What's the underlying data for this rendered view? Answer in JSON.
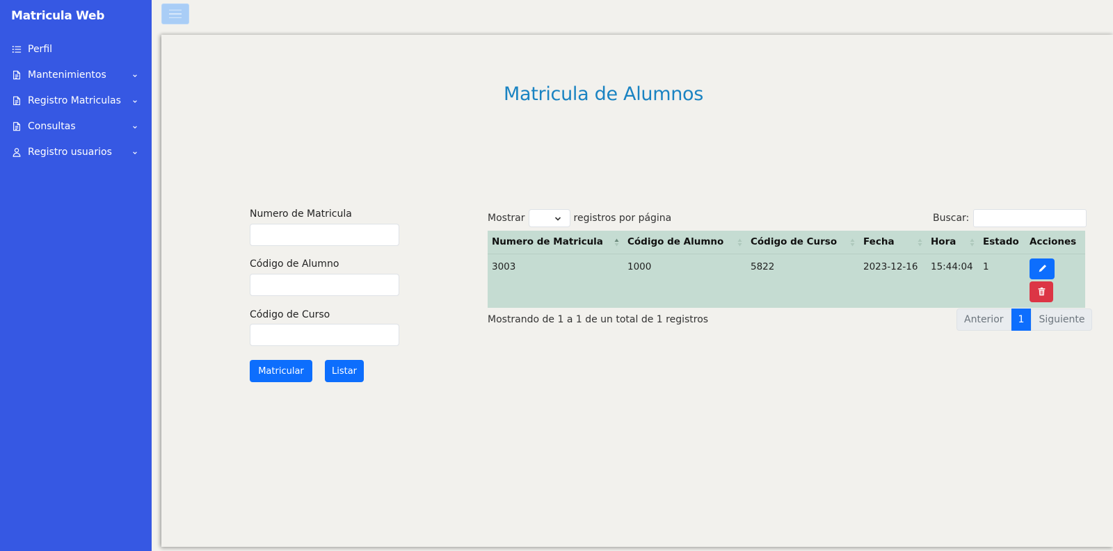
{
  "sidebar": {
    "brand": "Matricula Web",
    "items": [
      {
        "label": "Perfil",
        "icon": "list-icon",
        "expandable": false
      },
      {
        "label": "Mantenimientos",
        "icon": "document-icon",
        "expandable": true
      },
      {
        "label": "Registro Matriculas",
        "icon": "document-icon",
        "expandable": true
      },
      {
        "label": "Consultas",
        "icon": "document-icon",
        "expandable": true
      },
      {
        "label": "Registro usuarios",
        "icon": "user-icon",
        "expandable": true
      }
    ]
  },
  "header": {
    "toggle_icon": "hamburger-icon"
  },
  "main": {
    "title": "Matricula de Alumnos",
    "form": {
      "fields": [
        {
          "label": "Numero de Matricula",
          "value": ""
        },
        {
          "label": "Código de Alumno",
          "value": ""
        },
        {
          "label": "Código de Curso",
          "value": ""
        }
      ],
      "submit_label": "Matricular",
      "list_label": "Listar"
    },
    "table": {
      "length_prefix": "Mostrar",
      "length_value": "",
      "length_suffix": "registros por página",
      "search_label": "Buscar:",
      "search_value": "",
      "columns": [
        "Numero de Matricula",
        "Código de Alumno",
        "Código de Curso",
        "Fecha",
        "Hora",
        "Estado",
        "Acciones"
      ],
      "rows": [
        {
          "numero": "3003",
          "alumno": "1000",
          "curso": "5822",
          "fecha": "2023-12-16",
          "hora": "15:44:04",
          "estado": "1"
        }
      ],
      "info": "Mostrando de 1 a 1 de un total de 1 registros",
      "pagination": {
        "prev": "Anterior",
        "current": "1",
        "next": "Siguiente"
      }
    }
  },
  "colors": {
    "sidebar": "#3658e3",
    "accent": "#0d6efd",
    "danger": "#dc3545",
    "title": "#1a83c2",
    "row": "#c5dcd2"
  }
}
